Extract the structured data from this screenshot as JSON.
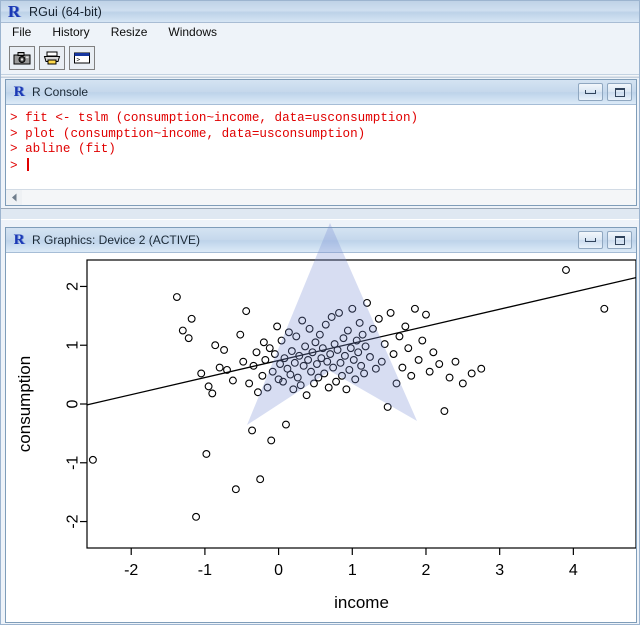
{
  "app": {
    "title": "RGui (64-bit)",
    "logo_glyph": "R"
  },
  "menu": {
    "items": [
      {
        "label": "File"
      },
      {
        "label": "History"
      },
      {
        "label": "Resize"
      },
      {
        "label": "Windows"
      }
    ]
  },
  "toolbar": {
    "buttons": [
      {
        "name": "copy-to-clipboard-button",
        "icon": "camera-icon",
        "label": ""
      },
      {
        "name": "print-button",
        "icon": "printer-icon",
        "label": ""
      },
      {
        "name": "show-console-button",
        "icon": "console-window-icon",
        "label": ""
      }
    ]
  },
  "console_window": {
    "title": "R Console",
    "minimize_label": "",
    "maximize_label": "",
    "lines": [
      "> fit <- tslm (consumption~income, data=usconsumption)",
      "> plot (consumption~income, data=usconsumption)",
      "> abline (fit)",
      "> "
    ],
    "prompt_color": "#e00000"
  },
  "graphics_window": {
    "title": "R Graphics: Device 2 (ACTIVE)",
    "minimize_label": "",
    "maximize_label": ""
  },
  "chart_data": {
    "type": "scatter",
    "title": "",
    "xlabel": "income",
    "ylabel": "consumption",
    "xlim": [
      -2.6,
      4.85
    ],
    "ylim": [
      -2.45,
      2.45
    ],
    "xticks": [
      -2,
      -1,
      0,
      1,
      2,
      3,
      4
    ],
    "yticks": [
      -2,
      -1,
      0,
      1,
      2
    ],
    "grid": false,
    "legend": "none",
    "point_symbol": "open-circle",
    "point_color": "#000000",
    "fit_line": {
      "label": "abline(fit)",
      "color": "#000000",
      "intercept": 0.74,
      "slope": 0.29,
      "x_start": -2.6,
      "x_end": 4.85,
      "y_start": -0.015,
      "y_end": 2.15
    },
    "x": [
      -2.52,
      -1.38,
      -1.3,
      -1.22,
      -1.18,
      -1.12,
      -1.05,
      -0.98,
      -0.95,
      -0.9,
      -0.86,
      -0.8,
      -0.74,
      -0.7,
      -0.62,
      -0.58,
      -0.52,
      -0.48,
      -0.44,
      -0.4,
      -0.36,
      -0.34,
      -0.3,
      -0.28,
      -0.25,
      -0.22,
      -0.2,
      -0.18,
      -0.15,
      -0.12,
      -0.1,
      -0.08,
      -0.05,
      -0.02,
      0.0,
      0.02,
      0.04,
      0.06,
      0.08,
      0.1,
      0.12,
      0.14,
      0.16,
      0.18,
      0.2,
      0.22,
      0.24,
      0.26,
      0.28,
      0.3,
      0.32,
      0.34,
      0.36,
      0.38,
      0.4,
      0.42,
      0.44,
      0.46,
      0.48,
      0.5,
      0.52,
      0.54,
      0.56,
      0.58,
      0.6,
      0.62,
      0.64,
      0.66,
      0.68,
      0.7,
      0.72,
      0.74,
      0.76,
      0.78,
      0.8,
      0.82,
      0.84,
      0.86,
      0.88,
      0.9,
      0.92,
      0.94,
      0.96,
      0.98,
      1.0,
      1.02,
      1.04,
      1.06,
      1.08,
      1.1,
      1.12,
      1.14,
      1.16,
      1.18,
      1.2,
      1.24,
      1.28,
      1.32,
      1.36,
      1.4,
      1.44,
      1.48,
      1.52,
      1.56,
      1.6,
      1.64,
      1.68,
      1.72,
      1.76,
      1.8,
      1.85,
      1.9,
      1.95,
      2.0,
      2.05,
      2.1,
      2.18,
      2.25,
      2.32,
      2.4,
      2.5,
      2.62,
      2.75,
      3.9,
      4.42
    ],
    "y": [
      -0.95,
      1.82,
      1.25,
      1.12,
      1.45,
      -1.92,
      0.52,
      -0.85,
      0.3,
      0.18,
      1.0,
      0.62,
      0.92,
      0.58,
      0.4,
      -1.45,
      1.18,
      0.72,
      1.58,
      0.35,
      -0.45,
      0.65,
      0.88,
      0.2,
      -1.28,
      0.48,
      1.05,
      0.75,
      0.28,
      0.95,
      -0.62,
      0.55,
      0.85,
      1.32,
      0.42,
      0.68,
      1.08,
      0.38,
      0.78,
      -0.35,
      0.6,
      1.22,
      0.5,
      0.9,
      0.25,
      0.7,
      1.15,
      0.45,
      0.82,
      0.32,
      1.42,
      0.65,
      0.98,
      0.15,
      0.75,
      1.28,
      0.55,
      0.88,
      0.35,
      1.05,
      0.68,
      0.45,
      1.18,
      0.78,
      0.95,
      0.52,
      1.35,
      0.72,
      0.28,
      0.85,
      1.48,
      0.62,
      1.02,
      0.38,
      0.92,
      1.55,
      0.7,
      0.48,
      1.12,
      0.82,
      0.25,
      1.25,
      0.58,
      0.95,
      1.62,
      0.75,
      0.42,
      1.08,
      0.88,
      1.38,
      0.65,
      1.18,
      0.52,
      0.98,
      1.72,
      0.8,
      1.28,
      0.6,
      1.45,
      0.72,
      1.02,
      -0.05,
      1.55,
      0.85,
      0.35,
      1.15,
      0.62,
      1.32,
      0.95,
      0.48,
      1.62,
      0.75,
      1.08,
      1.52,
      0.55,
      0.88,
      0.68,
      -0.12,
      0.45,
      0.72,
      0.35,
      0.52,
      0.6,
      2.28,
      1.62
    ]
  }
}
